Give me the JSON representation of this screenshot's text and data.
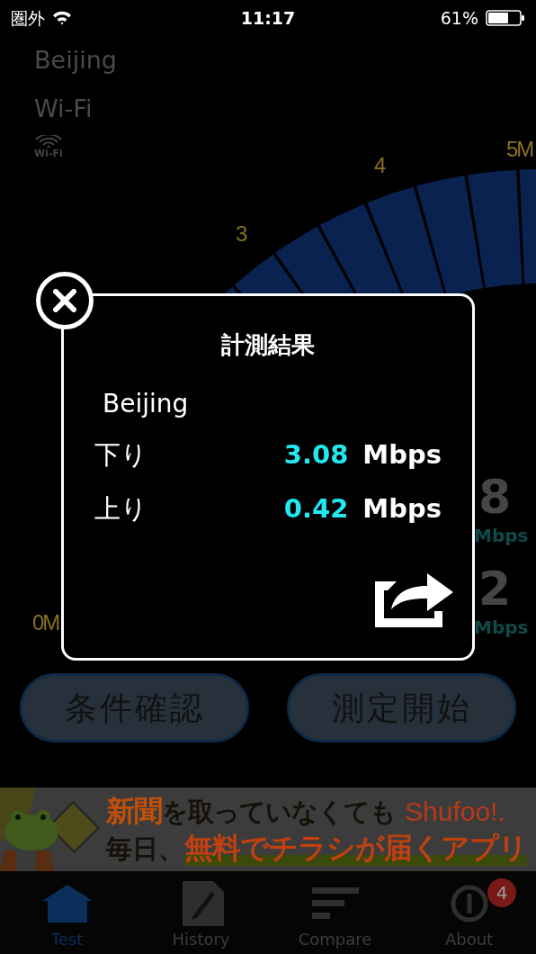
{
  "status_bar": {
    "carrier": "圏外",
    "time": "11:17",
    "battery": "61%"
  },
  "background": {
    "location": "Beijing",
    "network": "Wi-Fi",
    "network_icon_label": "Wi-Fi",
    "gauge_labels": [
      "3",
      "4",
      "5M",
      "0M"
    ],
    "download_partial": "8",
    "download_unit": "Mbps",
    "upload_partial": "2",
    "upload_unit": "Mbps"
  },
  "buttons": [
    "条件確認",
    "測定開始"
  ],
  "ad_banner": {
    "line_1_highlight": "新聞",
    "line_1": "を取っていなくても",
    "brand": "Shufoo!.",
    "line_2": "毎日、",
    "line_2_highlight": "無料でチラシが届くアプリ"
  },
  "tabs": [
    {
      "label": "Test",
      "selected": true,
      "kind": "home"
    },
    {
      "label": "History",
      "selected": false,
      "kind": "history"
    },
    {
      "label": "Compare",
      "selected": false,
      "kind": "compare"
    },
    {
      "label": "About",
      "selected": false,
      "kind": "about",
      "badge": "4"
    }
  ],
  "dialog": {
    "title": "計測結果",
    "location": "Beijing",
    "results": [
      {
        "label": "下り",
        "value": "3.08",
        "unit": "Mbps"
      },
      {
        "label": "上り",
        "value": "0.42",
        "unit": "Mbps"
      }
    ]
  }
}
